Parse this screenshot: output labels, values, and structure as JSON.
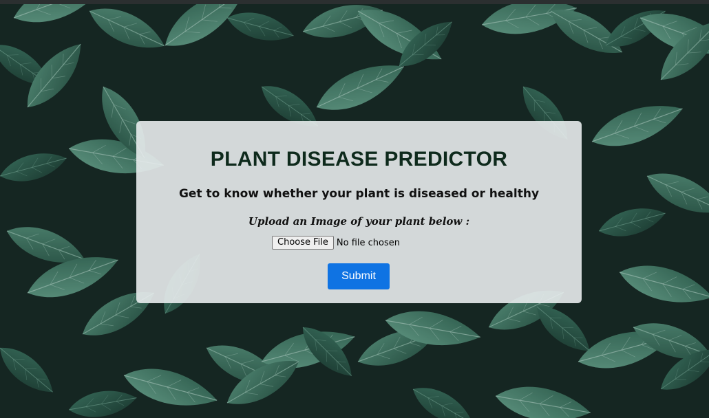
{
  "header": {
    "title": "PLANT DISEASE PREDICTOR",
    "subtitle": "Get to know whether your plant is diseased or healthy"
  },
  "upload": {
    "label": "Upload an Image of your plant below :",
    "choose_button_label": "Choose File",
    "file_status": "No file chosen"
  },
  "form": {
    "submit_label": "Submit"
  },
  "colors": {
    "accent": "#0f73e3",
    "title": "#0e2a1c",
    "background": "#1c2a26"
  }
}
